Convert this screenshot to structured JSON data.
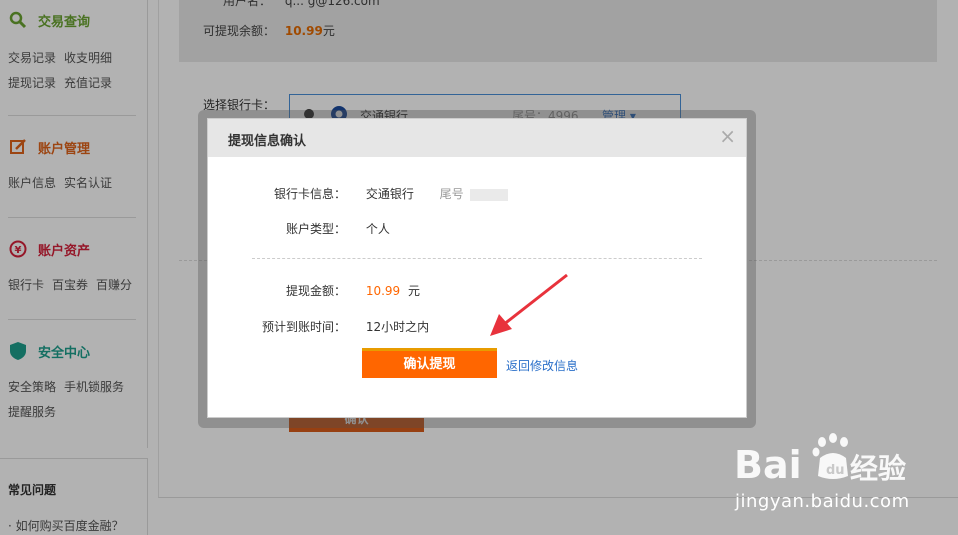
{
  "sidebar": {
    "sections": [
      {
        "title": "交易查询",
        "color": "#6aa431",
        "links": [
          "交易记录",
          "收支明细",
          "提现记录",
          "充值记录"
        ]
      },
      {
        "title": "账户管理",
        "color": "#e0641b",
        "links": [
          "账户信息",
          "实名认证"
        ]
      },
      {
        "title": "账户资产",
        "color": "#d6223b",
        "links": [
          "银行卡",
          "百宝券",
          "百赚分"
        ]
      },
      {
        "title": "安全中心",
        "color": "#1e9f8d",
        "links": [
          "安全策略",
          "手机锁服务",
          "提醒服务"
        ]
      }
    ],
    "faq_title": "常见问题",
    "faq_item": "· 如何购买百度金融？"
  },
  "main": {
    "username_label": "用户名：",
    "username_value": "q... g@126.com",
    "balance_label": "可提现余额：",
    "balance_value": "10.99",
    "balance_unit": "元",
    "card_label": "选择银行卡：",
    "card_bank": "交通银行",
    "card_tail": "尾号：4996",
    "card_manage": "管理 ▾",
    "confirm_bottom": "确认"
  },
  "dialog": {
    "title": "提现信息确认",
    "close": "×",
    "bank_label": "银行卡信息：",
    "bank_value": "交通银行",
    "tail_label": "尾号",
    "type_label": "账户类型：",
    "type_value": "个人",
    "amount_label": "提现金额：",
    "amount_value": "10.99",
    "amount_unit": "元",
    "eta_label": "预计到账时间：",
    "eta_value": "12小时之内",
    "confirm_button": "确认提现",
    "back_link": "返回修改信息"
  },
  "watermark": {
    "brand": "Bai",
    "brand2": "经验",
    "url": "jingyan.baidu.com"
  },
  "colors": {
    "accent_orange": "#ff6600",
    "link_blue": "#2a6fc9",
    "money": "#e66a00"
  }
}
